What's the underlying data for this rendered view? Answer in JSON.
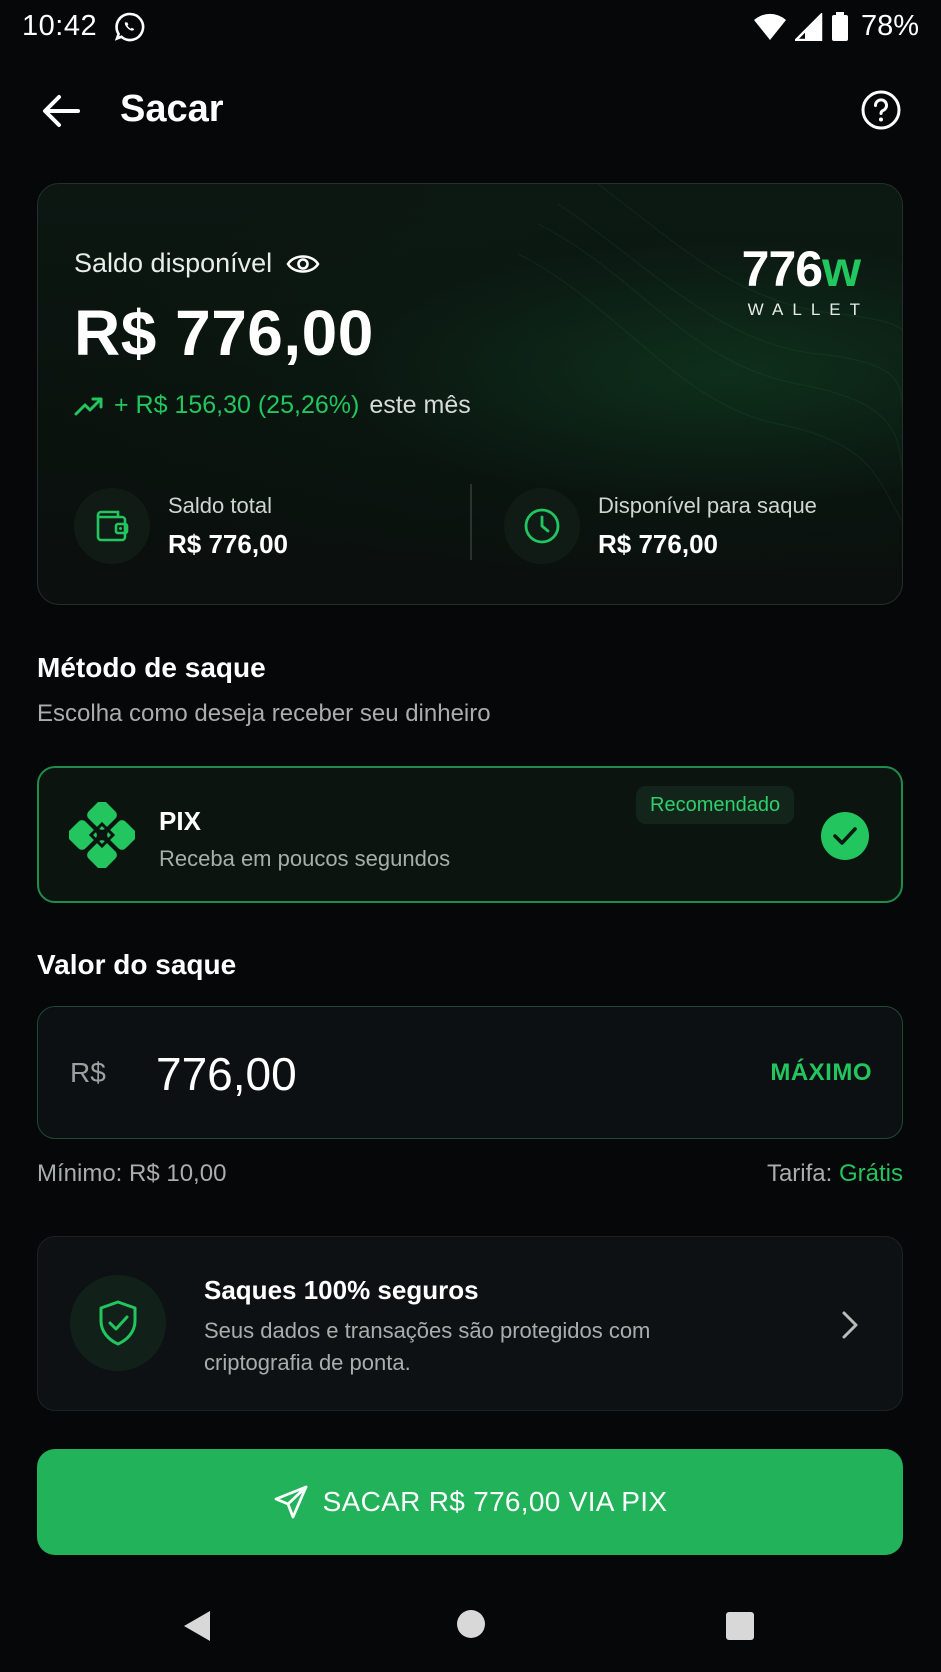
{
  "status_bar": {
    "time": "10:42",
    "battery": "78%"
  },
  "header": {
    "title": "Sacar"
  },
  "balance": {
    "label": "Saldo disponível",
    "amount": "R$ 776,00",
    "growth_value": "+ R$ 156,30 (25,26%)",
    "growth_suffix": "este mês",
    "brand_mark_number": "776",
    "brand_mark_letter": "w",
    "brand_sub": "WALLET",
    "total_label": "Saldo total",
    "total_value": "R$ 776,00",
    "available_label": "Disponível para saque",
    "available_value": "R$ 776,00"
  },
  "method": {
    "title": "Método de saque",
    "subtitle": "Escolha como deseja receber seu dinheiro",
    "option": {
      "name": "PIX",
      "description": "Receba em poucos segundos",
      "badge": "Recomendado",
      "selected": true
    }
  },
  "amount": {
    "title": "Valor do saque",
    "currency": "R$",
    "value": "776,00",
    "max_label": "MÁXIMO",
    "min_text": "Mínimo: R$ 10,00",
    "fee_label": "Tarifa:",
    "fee_value": "Grátis"
  },
  "security": {
    "title": "Saques 100% seguros",
    "description": "Seus dados e transações são protegidos com criptografia de ponta."
  },
  "cta": {
    "label": "SACAR R$ 776,00 VIA PIX"
  },
  "colors": {
    "accent": "#22c55e",
    "background": "#060708",
    "button": "#22b35a"
  }
}
